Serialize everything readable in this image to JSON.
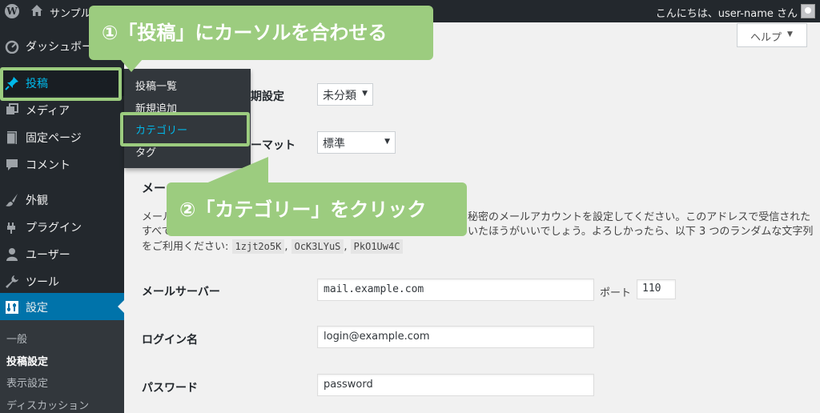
{
  "admin_bar": {
    "wp_logo_letter": "W",
    "site_name": "サンプル",
    "greeting": "こんにちは、user-name さん"
  },
  "sidebar": {
    "items": [
      {
        "label": "ダッシュボー",
        "icon": "dashboard-icon"
      },
      {
        "label": "投稿",
        "icon": "pin-icon"
      },
      {
        "label": "メディア",
        "icon": "media-icon"
      },
      {
        "label": "固定ページ",
        "icon": "page-icon"
      },
      {
        "label": "コメント",
        "icon": "comment-icon"
      },
      {
        "label": "外観",
        "icon": "brush-icon"
      },
      {
        "label": "プラグイン",
        "icon": "plugin-icon"
      },
      {
        "label": "ユーザー",
        "icon": "user-icon"
      },
      {
        "label": "ツール",
        "icon": "wrench-icon"
      },
      {
        "label": "設定",
        "icon": "settings-icon"
      }
    ],
    "submenu": [
      "一般",
      "投稿設定",
      "表示設定",
      "ディスカッション"
    ]
  },
  "flyout": {
    "items": [
      "投稿一覧",
      "新規追加",
      "カテゴリー",
      "タグ"
    ]
  },
  "help": {
    "label": "ヘルプ"
  },
  "form": {
    "category_label": "期設定",
    "category_value": "未分類",
    "format_label": "ーマット",
    "format_value": "標準",
    "mail_section_title": "メー",
    "desc_line1_prefix": "メール",
    "desc_line1_suffix": "秘密のメールアカウントを設定してください。このアドレスで受信された",
    "desc_line2_prefix": "すべて",
    "desc_line2_suffix": "いたほうがいいでしょう。よろしかったら、以下 3 つのランダムな文字列",
    "desc_line3_prefix": "をご利用ください:",
    "codes": [
      "1zjt2o5K",
      "OcK3LYuS",
      "PkO1Uw4C"
    ],
    "mail_server_label": "メールサーバー",
    "mail_server_value": "mail.example.com",
    "port_label": "ポート",
    "port_value": "110",
    "login_label": "ログイン名",
    "login_value": "login@example.com",
    "password_label": "パスワード",
    "password_value": "password"
  },
  "callouts": {
    "step1": "①「投稿」にカーソルを合わせる",
    "step2": "②「カテゴリー」をクリック",
    "color": "#9ccc7f"
  },
  "colors": {
    "admin_bg": "#23282d",
    "accent": "#0073aa",
    "hover_text": "#00b9eb"
  }
}
